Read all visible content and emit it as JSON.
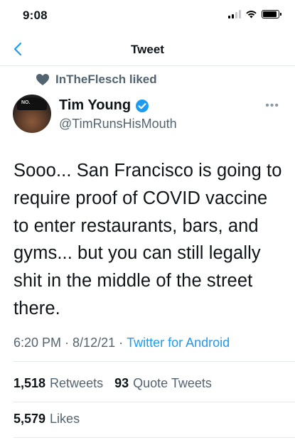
{
  "status_bar": {
    "time": "9:08"
  },
  "nav": {
    "title": "Tweet",
    "back_icon": "chevron-left-icon"
  },
  "social_context": {
    "icon": "heart-icon",
    "text": "InTheFlesch liked"
  },
  "author": {
    "name": "Tim Young",
    "handle": "@TimRunsHisMouth",
    "verified": true,
    "avatar_hat_text": "NO."
  },
  "tweet": {
    "text": "Sooo... San Francisco is going to require proof of COVID vaccine to enter restaurants, bars, and gyms... but you can still legally shit in the middle of the street there.",
    "time": "6:20 PM",
    "date": "8/12/21",
    "source": "Twitter for Android"
  },
  "stats": {
    "retweets_count": "1,518",
    "retweets_label": "Retweets",
    "quotes_count": "93",
    "quotes_label": "Quote Tweets",
    "likes_count": "5,579",
    "likes_label": "Likes"
  },
  "colors": {
    "accent": "#1d9bf0",
    "secondary_text": "#536471",
    "primary_text": "#0f1419"
  }
}
